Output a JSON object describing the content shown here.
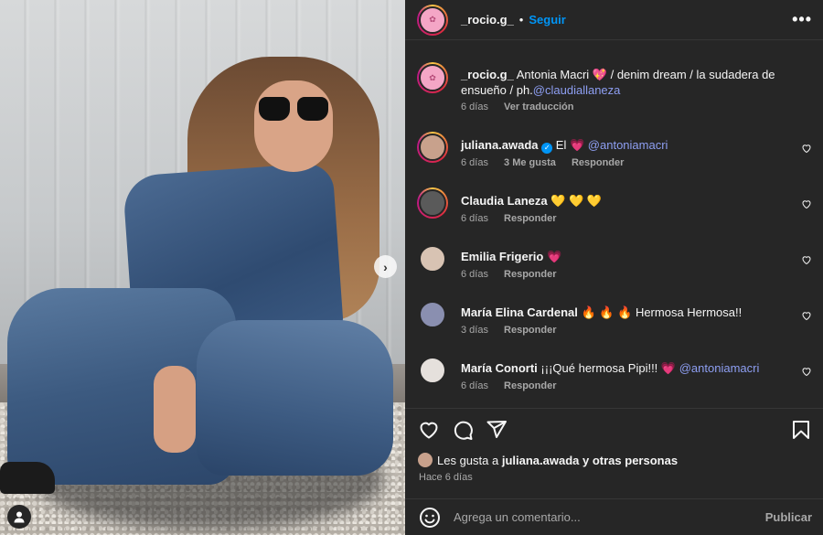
{
  "post": {
    "author": "_rocio.g_",
    "follow_label": "Seguir",
    "dot": "•",
    "more": "•••",
    "caption": {
      "user": "_rocio.g_",
      "text": "Antonia Macri 💖 / denim dream / la sudadera de ensueño / ph.",
      "mention": "@claudiallaneza",
      "time": "6 días",
      "translate": "Ver traducción"
    }
  },
  "comments": [
    {
      "user": "juliana.awada",
      "verified": true,
      "text_before": "El",
      "emoji": "💗",
      "mention": "@antoniamacri",
      "text_after": "",
      "time": "6 días",
      "likes": "3 Me gusta",
      "reply": "Responder"
    },
    {
      "user": "Claudia Laneza",
      "verified": false,
      "text_before": "",
      "emoji": "💛 💛 💛",
      "mention": "",
      "text_after": "",
      "time": "6 días",
      "likes": "",
      "reply": "Responder"
    },
    {
      "user": "Emilia Frigerio",
      "verified": false,
      "text_before": "",
      "emoji": "💗",
      "mention": "",
      "text_after": "",
      "time": "6 días",
      "likes": "",
      "reply": "Responder"
    },
    {
      "user": "María Elina Cardenal",
      "verified": false,
      "text_before": "",
      "emoji": "🔥 🔥 🔥",
      "mention": "",
      "text_after": "Hermosa Hermosa!!",
      "time": "3 días",
      "likes": "",
      "reply": "Responder"
    },
    {
      "user": "María Conorti",
      "verified": false,
      "text_before": "¡¡¡Qué hermosa Pipi!!!",
      "emoji": "💗",
      "mention": "@antoniamacri",
      "text_after": "",
      "time": "6 días",
      "likes": "",
      "reply": "Responder"
    }
  ],
  "likes_summary": {
    "prefix": "Les gusta a",
    "user": "juliana.awada",
    "suffix": "y otras personas"
  },
  "posted_ago": "Hace 6 días",
  "composer": {
    "placeholder": "Agrega un comentario...",
    "publish_label": "Publicar"
  },
  "icons": {
    "next": "chevron-right-icon",
    "tag": "user-tag-icon",
    "like": "heart-icon",
    "comment": "comment-icon",
    "share": "share-icon",
    "save": "bookmark-icon",
    "emoji": "emoji-icon"
  },
  "colors": {
    "panel_bg": "#262626",
    "link_blue": "#0095f6",
    "mention": "#8e9ff3",
    "muted": "#a8a8a8"
  }
}
